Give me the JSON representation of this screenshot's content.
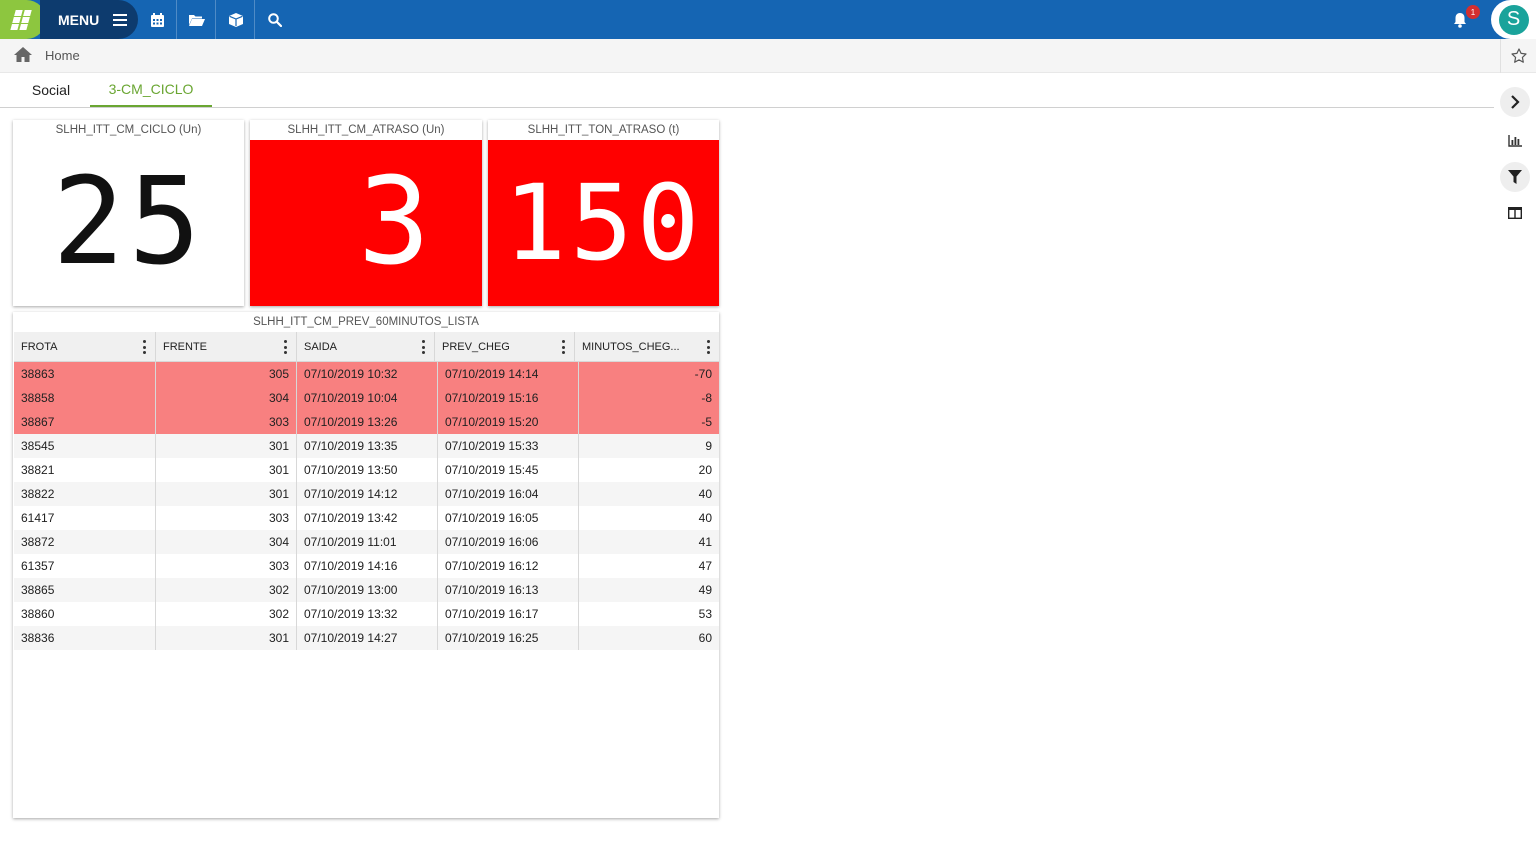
{
  "topbar": {
    "menu_label": "MENU",
    "notification_count": "1",
    "avatar_letter": "S",
    "brand_color": "#1565b3",
    "logo_color": "#8dc63f"
  },
  "breadcrumb": {
    "home": "Home"
  },
  "tabs": [
    {
      "label": "Social",
      "active": false
    },
    {
      "label": "3-CM_CICLO",
      "active": true
    }
  ],
  "kpis": [
    {
      "title": "SLHH_ITT_CM_CICLO (Un)",
      "value": "25",
      "alert": false
    },
    {
      "title": "SLHH_ITT_CM_ATRASO (Un)",
      "value": "3",
      "alert": true
    },
    {
      "title": "SLHH_ITT_TON_ATRASO (t)",
      "value": "150",
      "alert": true
    }
  ],
  "table": {
    "title": "SLHH_ITT_CM_PREV_60MINUTOS_LISTA",
    "columns": [
      "FROTA",
      "FRENTE",
      "SAIDA",
      "PREV_CHEG",
      "MINUTOS_CHEG..."
    ],
    "rows": [
      {
        "cells": [
          "38863",
          "305",
          "07/10/2019 10:32",
          "07/10/2019 14:14",
          "-70"
        ],
        "late": true
      },
      {
        "cells": [
          "38858",
          "304",
          "07/10/2019 10:04",
          "07/10/2019 15:16",
          "-8"
        ],
        "late": true
      },
      {
        "cells": [
          "38867",
          "303",
          "07/10/2019 13:26",
          "07/10/2019 15:20",
          "-5"
        ],
        "late": true
      },
      {
        "cells": [
          "38545",
          "301",
          "07/10/2019 13:35",
          "07/10/2019 15:33",
          "9"
        ],
        "late": false
      },
      {
        "cells": [
          "38821",
          "301",
          "07/10/2019 13:50",
          "07/10/2019 15:45",
          "20"
        ],
        "late": false
      },
      {
        "cells": [
          "38822",
          "301",
          "07/10/2019 14:12",
          "07/10/2019 16:04",
          "40"
        ],
        "late": false
      },
      {
        "cells": [
          "61417",
          "303",
          "07/10/2019 13:42",
          "07/10/2019 16:05",
          "40"
        ],
        "late": false
      },
      {
        "cells": [
          "38872",
          "304",
          "07/10/2019 11:01",
          "07/10/2019 16:06",
          "41"
        ],
        "late": false
      },
      {
        "cells": [
          "61357",
          "303",
          "07/10/2019 14:16",
          "07/10/2019 16:12",
          "47"
        ],
        "late": false
      },
      {
        "cells": [
          "38865",
          "302",
          "07/10/2019 13:00",
          "07/10/2019 16:13",
          "49"
        ],
        "late": false
      },
      {
        "cells": [
          "38860",
          "302",
          "07/10/2019 13:32",
          "07/10/2019 16:17",
          "53"
        ],
        "late": false
      },
      {
        "cells": [
          "38836",
          "301",
          "07/10/2019 14:27",
          "07/10/2019 16:25",
          "60"
        ],
        "late": false
      }
    ]
  },
  "colors": {
    "alert_red": "#ff0000",
    "late_row": "#f88080",
    "tab_active": "#6aa632"
  }
}
